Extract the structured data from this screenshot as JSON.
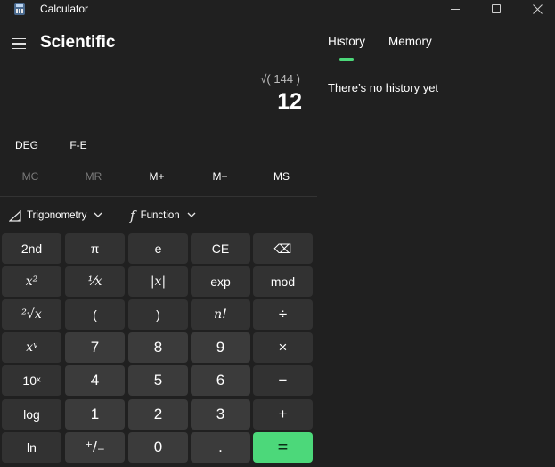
{
  "window": {
    "title": "Calculator"
  },
  "header": {
    "mode_title": "Scientific"
  },
  "display": {
    "expression": "√( 144 )",
    "result": "12"
  },
  "modes": {
    "angle": "DEG",
    "notation": "F-E"
  },
  "memory": [
    "MC",
    "MR",
    "M+",
    "M−",
    "MS"
  ],
  "functions": {
    "trigonometry": "Trigonometry",
    "function": "Function"
  },
  "keys": {
    "r1": [
      "2nd",
      "π",
      "e",
      "CE",
      "⌫"
    ],
    "r2": [
      "x²",
      "⅟x",
      "|x|",
      "exp",
      "mod"
    ],
    "r3": [
      "²√x",
      "(",
      ")",
      "n!",
      "÷"
    ],
    "r4": [
      "xʸ",
      "7",
      "8",
      "9",
      "×"
    ],
    "r5": [
      "10ˣ",
      "4",
      "5",
      "6",
      "−"
    ],
    "r6": [
      "log",
      "1",
      "2",
      "3",
      "+"
    ],
    "r7": [
      "ln",
      "⁺/₋",
      "0",
      ".",
      "="
    ]
  },
  "side_panel": {
    "tabs": [
      "History",
      "Memory"
    ],
    "active_tab": "History",
    "empty_message": "There’s no history yet"
  },
  "colors": {
    "background": "#202020",
    "accent": "#4cd87a",
    "function_key": "#323232",
    "number_key": "#3b3b3b"
  }
}
